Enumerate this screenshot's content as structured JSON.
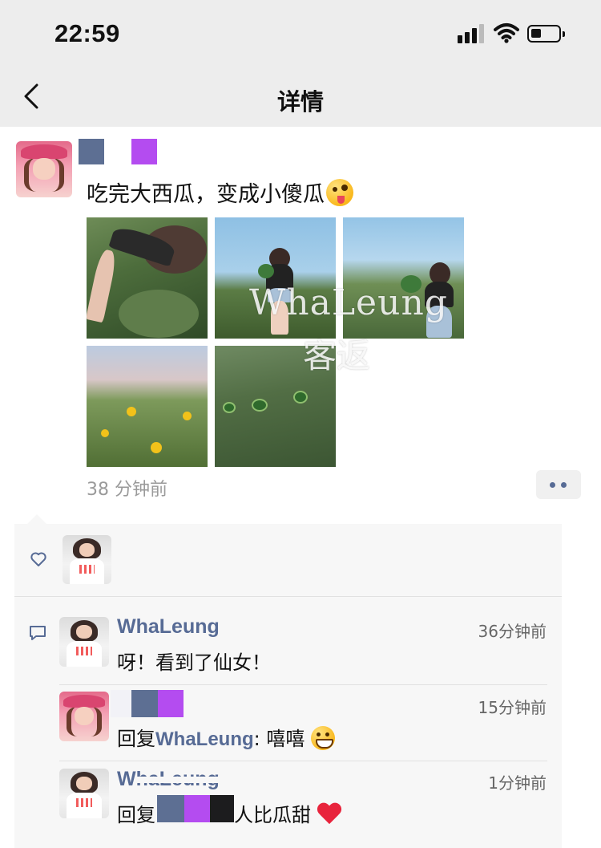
{
  "status_bar": {
    "time": "22:59",
    "icons": [
      "signal-icon",
      "wifi-icon",
      "battery-icon"
    ]
  },
  "navbar": {
    "title": "详情",
    "back_icon": "chevron-left-icon"
  },
  "post": {
    "text": "吃完大西瓜，变成小傻瓜",
    "emoji": "zany-face-emoji",
    "photos": [
      "photo-1",
      "photo-2",
      "photo-3",
      "photo-4",
      "photo-5"
    ],
    "watermark_line1": "WhaLeung",
    "watermark_line2": "客返",
    "time": "38 分钟前",
    "more_icon": "more-dots-icon"
  },
  "likes": {
    "icon": "heart-outline-icon",
    "users": [
      "avatar-whaleung"
    ]
  },
  "comments": {
    "icon": "comment-icon",
    "items": [
      {
        "name": "WhaLeung",
        "time": "36分钟前",
        "text": "呀！看到了仙女！"
      },
      {
        "name": "",
        "time": "15分钟前",
        "reply_prefix": "回复",
        "reply_to": "WhaLeung",
        "text": ": 嘻嘻",
        "emoji": "grinning-face-emoji"
      },
      {
        "name": "WhaLeung",
        "time": "1分钟前",
        "reply_prefix": "回复",
        "text": "人比瓜甜",
        "emoji": "red-heart-emoji"
      }
    ]
  },
  "colors": {
    "link_blue": "#576b95",
    "bar_bg": "#ededed",
    "interact_bg": "#f7f7f7",
    "censor_slate": "#5d6f93",
    "censor_purple": "#b44cf0"
  }
}
